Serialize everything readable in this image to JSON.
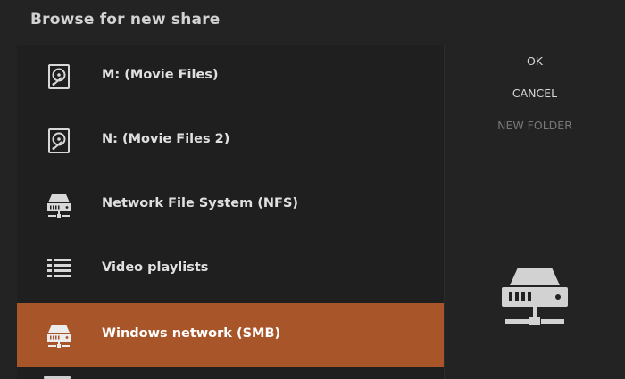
{
  "dialog": {
    "title": "Browse for new share"
  },
  "list": {
    "items": [
      {
        "label": "M: (Movie Files)",
        "icon": "hard-drive-icon",
        "selected": false
      },
      {
        "label": "N: (Movie Files 2)",
        "icon": "hard-drive-icon",
        "selected": false
      },
      {
        "label": "Network File System (NFS)",
        "icon": "network-drive-icon",
        "selected": false
      },
      {
        "label": "Video playlists",
        "icon": "playlist-icon",
        "selected": false
      },
      {
        "label": "Windows network (SMB)",
        "icon": "network-drive-icon",
        "selected": true
      }
    ]
  },
  "buttons": {
    "ok": "OK",
    "cancel": "CANCEL",
    "new_folder": "NEW FOLDER"
  },
  "preview": {
    "icon": "network-drive-icon"
  },
  "colors": {
    "selection": "#a8552a",
    "dialog_background": "#232323",
    "list_background": "#1f1f1f"
  }
}
